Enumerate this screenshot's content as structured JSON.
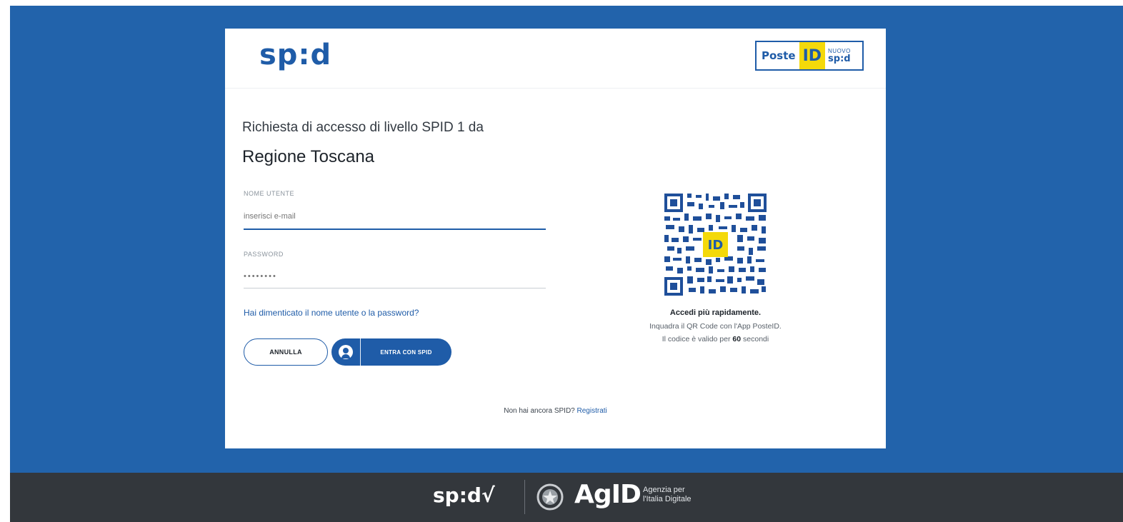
{
  "header": {
    "logo_text": "sp:d",
    "provider": {
      "brand": "Poste",
      "id_text": "ID",
      "badge_top": "NUOVO",
      "badge_bottom": "sp:d"
    }
  },
  "request": {
    "line": "Richiesta di accesso di livello SPID 1 da",
    "service_provider": "Regione Toscana"
  },
  "form": {
    "username_label": "NOME UTENTE",
    "username_placeholder": "inserisci e-mail",
    "password_label": "PASSWORD",
    "password_placeholder": "••••••••",
    "forgot_link": "Hai dimenticato il nome utente o la password?",
    "cancel_label": "ANNULLA",
    "submit_label": "ENTRA CON SPID"
  },
  "qr": {
    "center_label": "ID",
    "title": "Accedi più rapidamente.",
    "line1": "Inquadra il QR Code con l'App PosteID.",
    "line2_prefix": "Il codice è valido per",
    "line2_seconds": "60",
    "line2_suffix": "secondi"
  },
  "register": {
    "prefix": "Non hai ancora SPID?",
    "link": "Registrati"
  },
  "footer": {
    "spid_logo": "sp:d√",
    "agid_logo": "AgID",
    "agency_line1": "Agenzia per",
    "agency_line2": "l'Italia Digitale"
  },
  "colors": {
    "brand_blue": "#1f5ca8",
    "page_background": "#2263ab",
    "footer_background": "#33373c",
    "id_yellow": "#f4d90a"
  }
}
